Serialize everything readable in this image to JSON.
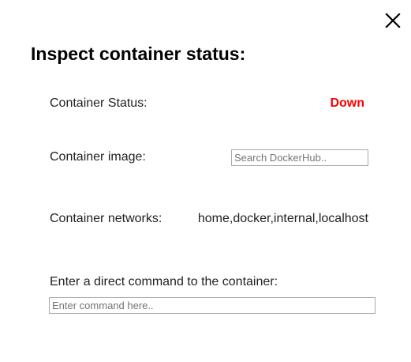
{
  "dialog": {
    "title": "Inspect container status:",
    "close_icon": "close-icon"
  },
  "status": {
    "label": "Container Status:",
    "value": "Down",
    "value_color": "#ff0000"
  },
  "image": {
    "label": "Container image:",
    "search_placeholder": "Search DockerHub..",
    "search_value": ""
  },
  "networks": {
    "label": "Container networks:",
    "value": "home,docker,internal,localhost"
  },
  "command": {
    "label": "Enter a direct command to the container:",
    "placeholder": "Enter command here..",
    "value": ""
  }
}
